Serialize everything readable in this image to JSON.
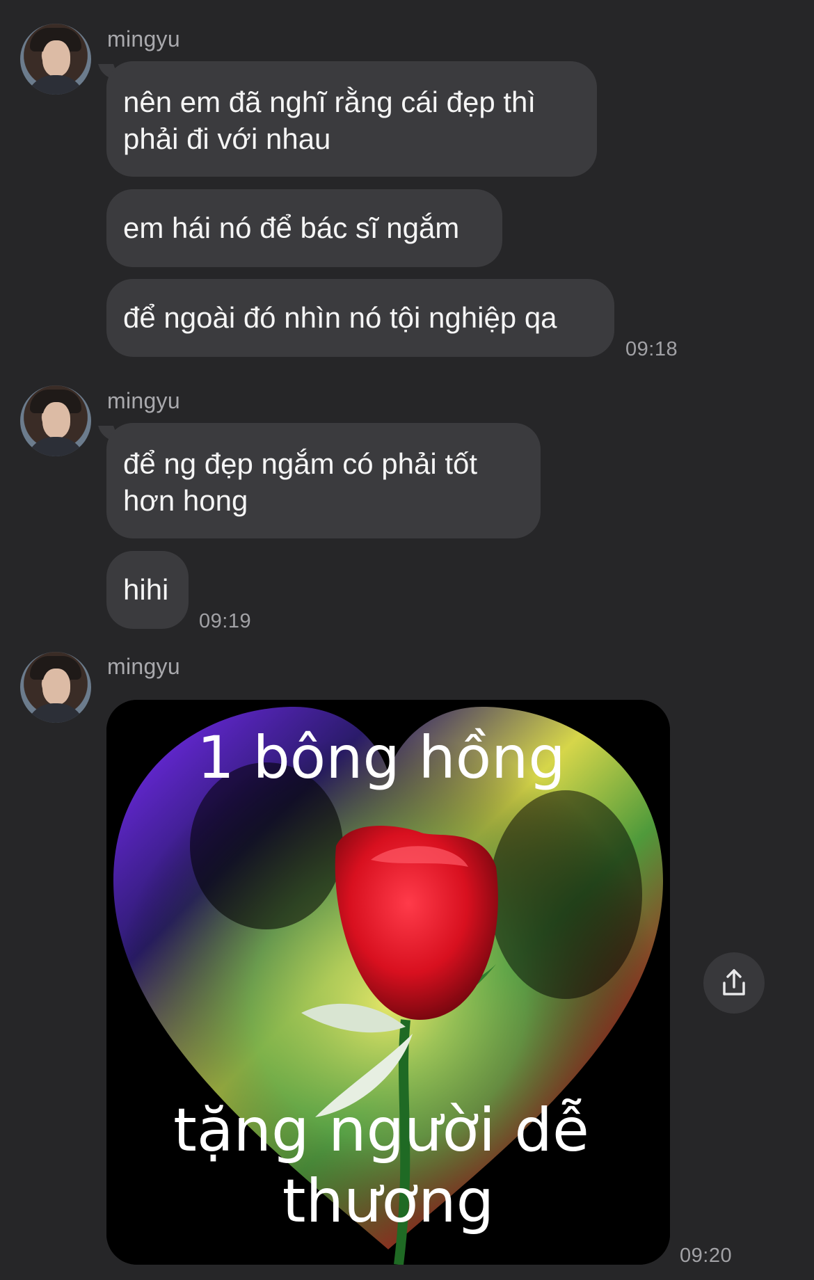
{
  "messages": [
    {
      "sender": "mingyu",
      "bubbles": [
        {
          "text": "nên em đã nghĩ rằng cái đẹp thì phải đi với nhau"
        },
        {
          "text": "em hái nó để bác sĩ ngắm"
        },
        {
          "text": "để ngoài đó nhìn nó tội nghiệp qa"
        }
      ],
      "time": "09:18"
    },
    {
      "sender": "mingyu",
      "bubbles": [
        {
          "text": "để ng đẹp ngắm có phải tốt hơn hong"
        },
        {
          "text": "hihi"
        }
      ],
      "time": "09:19"
    },
    {
      "sender": "mingyu",
      "image": {
        "top_text": "1 bông hồng",
        "bottom_text_line1": "tặng người dễ",
        "bottom_text_line2": "thương"
      },
      "time": "09:20"
    }
  ],
  "icons": {
    "share": "share-icon",
    "avatar": "profile-avatar"
  }
}
